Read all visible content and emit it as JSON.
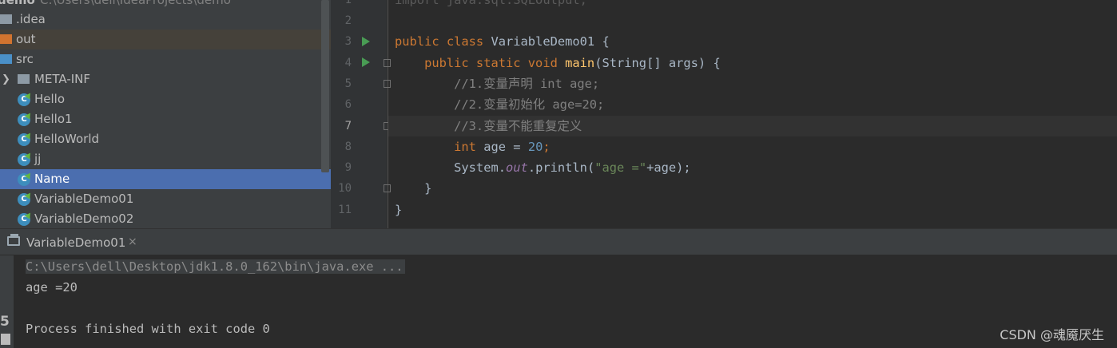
{
  "project_tree": {
    "root_name": "demo",
    "root_path": "C:\\Users\\dell\\IdeaProjects\\demo",
    "items": [
      {
        "label": ".idea",
        "kind": "folder"
      },
      {
        "label": "out",
        "kind": "folder"
      },
      {
        "label": "src",
        "kind": "folder"
      },
      {
        "label": "META-INF",
        "kind": "folder"
      },
      {
        "label": "Hello",
        "kind": "class"
      },
      {
        "label": "Hello1",
        "kind": "class"
      },
      {
        "label": "HelloWorld",
        "kind": "class"
      },
      {
        "label": "jj",
        "kind": "class"
      },
      {
        "label": "Name",
        "kind": "class",
        "selected": true
      },
      {
        "label": "VariableDemo01",
        "kind": "class"
      },
      {
        "label": "VariableDemo02",
        "kind": "class"
      }
    ],
    "class_icon_letter": "C"
  },
  "editor": {
    "line_numbers": [
      "1",
      "2",
      "3",
      "4",
      "5",
      "6",
      "7",
      "8",
      "9",
      "10",
      "11"
    ],
    "current_line": "7",
    "lines": {
      "l1": "import java.sql.SQLOutput;",
      "l3a": "public class ",
      "l3b": "VariableDemo01 {",
      "l4a": "    public static void ",
      "l4b": "main",
      "l4c": "(String[] args) {",
      "l5": "        //1.变量声明 int age;",
      "l6": "        //2.变量初始化 age=20;",
      "l7": "        //3.变量不能重复定义",
      "l8a": "        int ",
      "l8b": "age = ",
      "l8c": "20",
      "l8d": ";",
      "l9a": "        System.",
      "l9b": "out",
      "l9c": ".println(",
      "l9d": "\"age =\"",
      "l9e": "+age);",
      "l10": "    }",
      "l11": "}"
    }
  },
  "run_panel": {
    "tab_label": "VariableDemo01",
    "close_glyph": "×",
    "console": {
      "command": "C:\\Users\\dell\\Desktop\\jdk1.8.0_162\\bin\\java.exe ...",
      "output": "age =20",
      "exit_message": "Process finished with exit code 0"
    },
    "gutter_glyph": "5"
  },
  "watermark": "CSDN @魂魇厌生",
  "colors": {
    "keyword": "#cc7832",
    "method": "#ffc66d",
    "comment": "#808080",
    "number": "#6897bb",
    "string": "#6a8759",
    "field": "#9876aa",
    "selection": "#4b6eaf",
    "folder": "#8d9aa5",
    "out_folder": "#d2742f"
  }
}
